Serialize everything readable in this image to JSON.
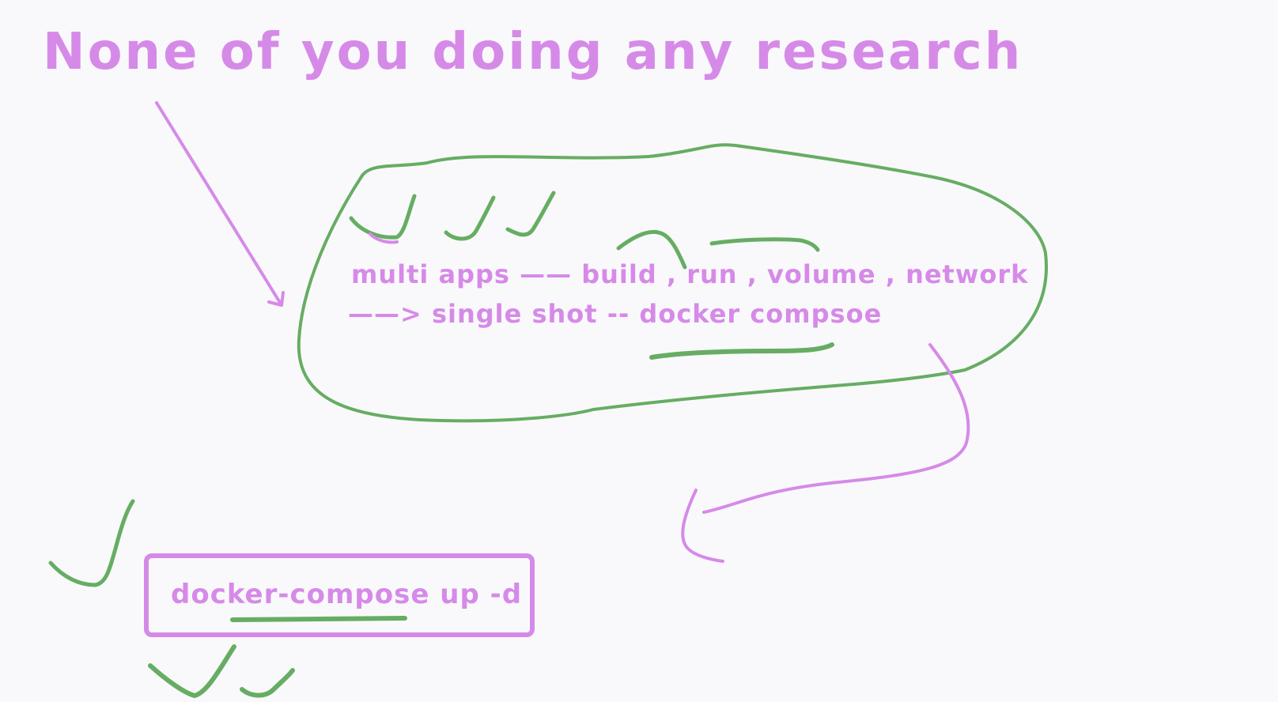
{
  "canvas": {
    "background": "#f9f9fb"
  },
  "colors": {
    "purple_ink": "#d68ae8",
    "green_ink": "#66ad63"
  },
  "annotations": {
    "title": "None of you doing any research",
    "line_one": "multi apps —— build , run , volume , network",
    "line_two": "——> single shot -- docker compsoe",
    "command": "docker-compose up -d"
  }
}
